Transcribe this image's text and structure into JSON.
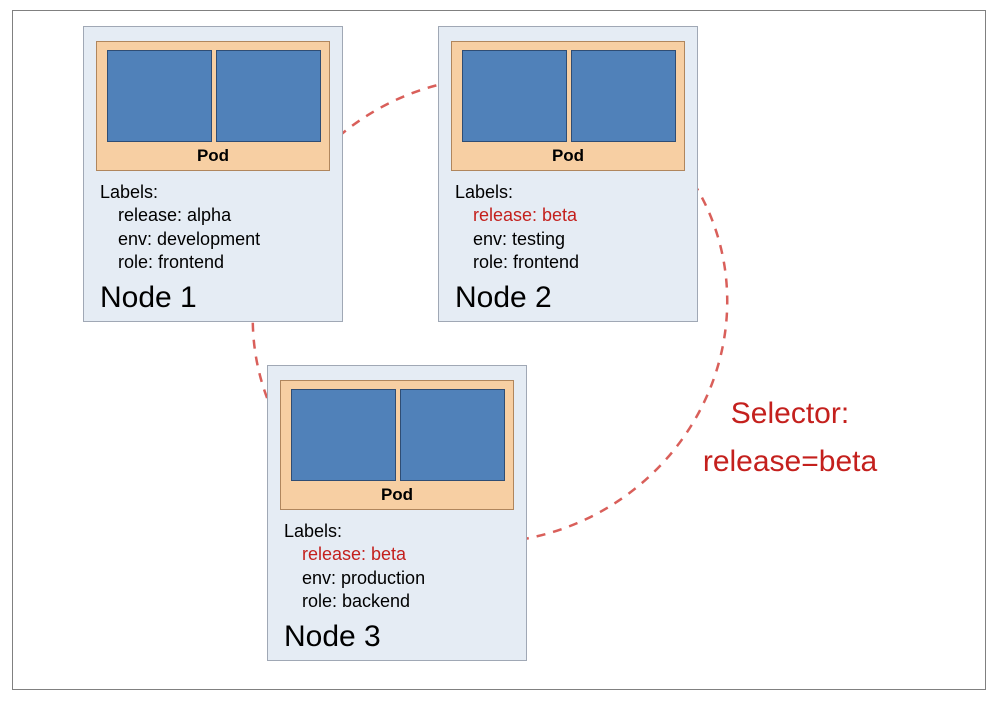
{
  "pod_label": "Pod",
  "labels_header": "Labels:",
  "node1": {
    "title": "Node 1",
    "release": "release: alpha",
    "env": "env: development",
    "role": "role: frontend",
    "highlight": false
  },
  "node2": {
    "title": "Node 2",
    "release": "release: beta",
    "env": "env: testing",
    "role": "role: frontend",
    "highlight": true
  },
  "node3": {
    "title": "Node 3",
    "release": "release: beta",
    "env": "env: production",
    "role": "role: backend",
    "highlight": true
  },
  "selector": {
    "line1": "Selector:",
    "line2": "release=beta"
  },
  "chart_data": {
    "type": "table",
    "title": "Kubernetes node/pod label selection diagram",
    "selector_expression": "release=beta",
    "nodes": [
      {
        "name": "Node 1",
        "labels": {
          "release": "alpha",
          "env": "development",
          "role": "frontend"
        },
        "matches_selector": false
      },
      {
        "name": "Node 2",
        "labels": {
          "release": "beta",
          "env": "testing",
          "role": "frontend"
        },
        "matches_selector": true
      },
      {
        "name": "Node 3",
        "labels": {
          "release": "beta",
          "env": "production",
          "role": "backend"
        },
        "matches_selector": true
      }
    ]
  }
}
